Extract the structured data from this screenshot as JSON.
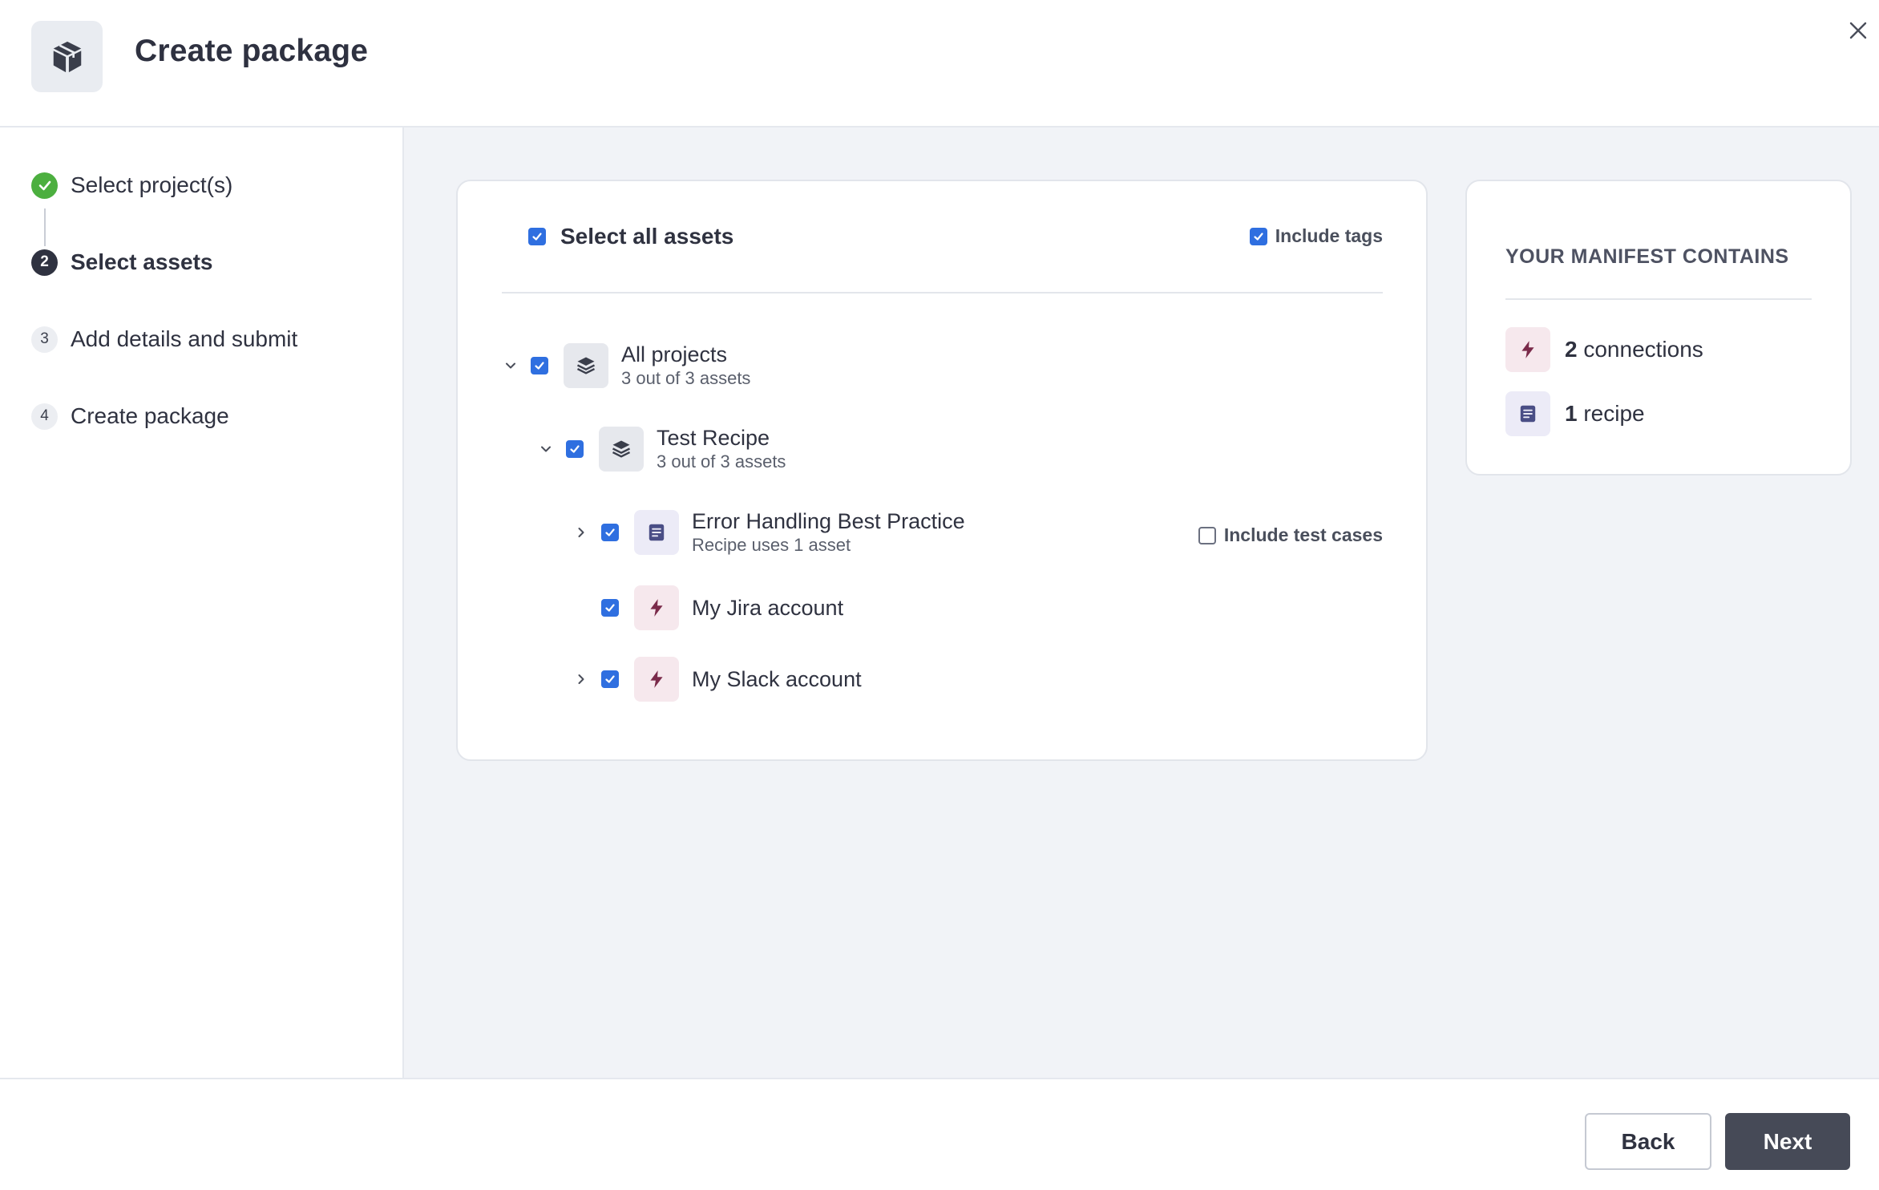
{
  "header": {
    "title": "Create package",
    "icon": "package-icon",
    "close_icon": "close-icon"
  },
  "steps": [
    {
      "label": "Select project(s)",
      "number": "1",
      "state": "done"
    },
    {
      "label": "Select assets",
      "number": "2",
      "state": "current"
    },
    {
      "label": "Add details and submit",
      "number": "3",
      "state": "pending"
    },
    {
      "label": "Create package",
      "number": "4",
      "state": "pending"
    }
  ],
  "assets": {
    "select_all_label": "Select all assets",
    "select_all_checked": true,
    "include_tags_label": "Include tags",
    "include_tags_checked": true,
    "include_test_cases_label": "Include test cases",
    "include_test_cases_checked": false,
    "tree": [
      {
        "name": "All projects",
        "subtitle": "3 out of 3 assets",
        "type": "project",
        "icon": "stack-icon",
        "expanded": true,
        "checked": true
      },
      {
        "name": "Test Recipe",
        "subtitle": "3 out of 3 assets",
        "type": "project",
        "icon": "stack-icon",
        "expanded": true,
        "checked": true
      },
      {
        "name": "Error Handling Best Practice",
        "subtitle": "Recipe uses 1 asset",
        "type": "recipe",
        "icon": "recipe-icon",
        "expanded": false,
        "checked": true
      },
      {
        "name": "My Jira account",
        "subtitle": "",
        "type": "connection",
        "icon": "lightning-icon",
        "checked": true
      },
      {
        "name": "My Slack account",
        "subtitle": "",
        "type": "connection",
        "icon": "lightning-icon",
        "expanded": false,
        "checked": true
      }
    ]
  },
  "manifest": {
    "title": "YOUR MANIFEST CONTAINS",
    "items": [
      {
        "count": "2",
        "label": "connections",
        "icon": "lightning-icon"
      },
      {
        "count": "1",
        "label": "recipe",
        "icon": "recipe-icon"
      }
    ]
  },
  "footer": {
    "back_label": "Back",
    "next_label": "Next"
  },
  "colors": {
    "accent_blue": "#2f6fe0",
    "step_done_green": "#4caf3f",
    "primary_button": "#464a57",
    "connection_icon": "#7a2a4a",
    "recipe_icon": "#4a4e86"
  }
}
